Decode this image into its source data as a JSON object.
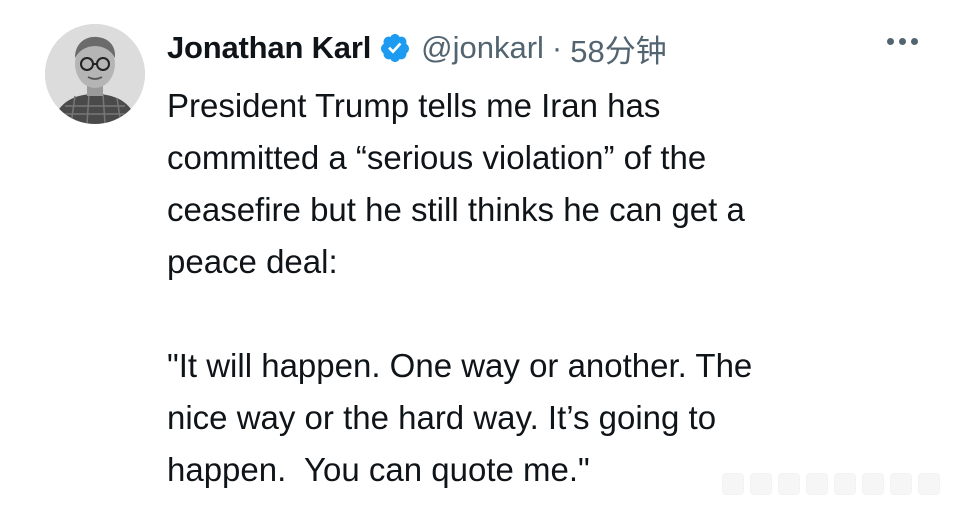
{
  "tweet": {
    "author_name": "Jonathan Karl",
    "handle": "@jonkarl",
    "separator": "·",
    "time": "58分钟",
    "verified_icon": "verified-badge-icon",
    "more_icon": "more-options-icon",
    "text_lines": [
      "President Trump tells me Iran has",
      "committed a “serious violation” of the",
      "ceasefire but he still thinks he can get a",
      "peace deal:"
    ],
    "quote_lines": [
      "\"It will happen. One way or another. The",
      "nice way or the hard way. It’s going to",
      "happen.  You can quote me.\""
    ]
  },
  "colors": {
    "text": "#0f1419",
    "secondary": "#536471",
    "verified_blue": "#1d9bf0"
  }
}
